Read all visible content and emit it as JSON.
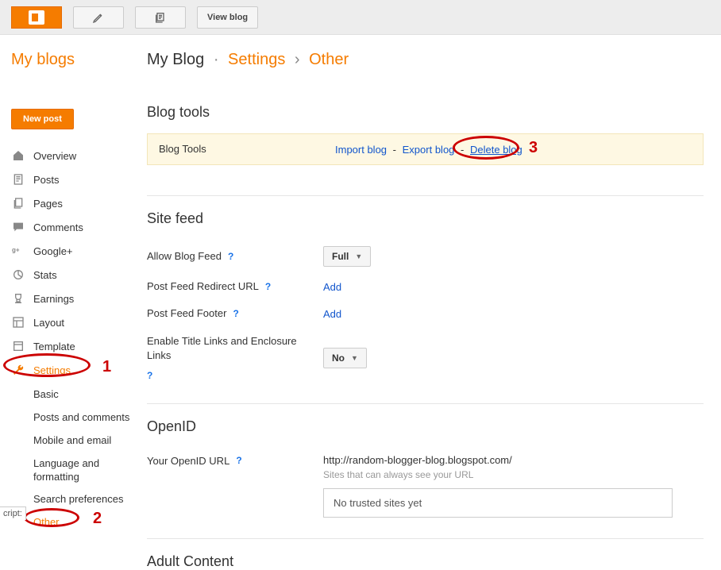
{
  "topbar": {
    "view_blog": "View blog"
  },
  "sidebar": {
    "title": "My blogs",
    "new_post": "New post",
    "items": {
      "overview": "Overview",
      "posts": "Posts",
      "pages": "Pages",
      "comments": "Comments",
      "googleplus": "Google+",
      "stats": "Stats",
      "earnings": "Earnings",
      "layout": "Layout",
      "template": "Template",
      "settings": "Settings"
    },
    "subitems": {
      "basic": "Basic",
      "posts_comments": "Posts and comments",
      "mobile_email": "Mobile and email",
      "lang_format": "Language and formatting",
      "search_prefs": "Search preferences",
      "other": "Other"
    }
  },
  "breadcrumb": {
    "blog": "My Blog",
    "settings": "Settings",
    "other": "Other",
    "dot": "·",
    "arrow": "›"
  },
  "blog_tools": {
    "heading": "Blog tools",
    "label": "Blog Tools",
    "import": "Import blog",
    "export": "Export blog",
    "delete": "Delete blog",
    "dash": "-"
  },
  "site_feed": {
    "heading": "Site feed",
    "allow_label": "Allow Blog Feed",
    "allow_value": "Full",
    "redirect_label": "Post Feed Redirect URL",
    "redirect_value": "Add",
    "footer_label": "Post Feed Footer",
    "footer_value": "Add",
    "enclosure_label": "Enable Title Links and Enclosure Links",
    "enclosure_value": "No",
    "help": "?"
  },
  "openid": {
    "heading": "OpenID",
    "label": "Your OpenID URL",
    "url": "http://random-blogger-blog.blogspot.com/",
    "hint": "Sites that can always see your URL",
    "trusted": "No trusted sites yet",
    "help": "?"
  },
  "adult": {
    "heading": "Adult Content"
  },
  "annotations": {
    "n1": "1",
    "n2": "2",
    "n3": "3"
  },
  "corner": "cript:"
}
